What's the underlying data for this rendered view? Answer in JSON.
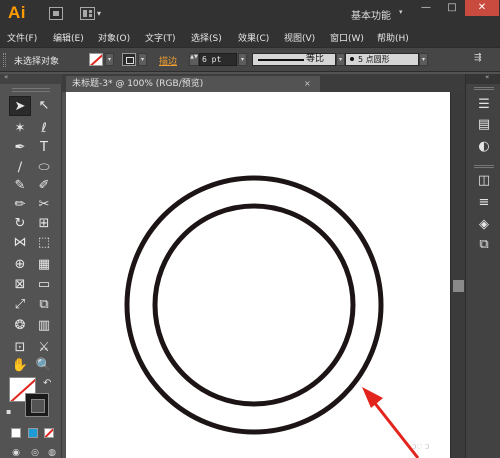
{
  "app": {
    "logo": "Ai",
    "workspace": "基本功能",
    "workspace_caret": "▾",
    "window_controls": {
      "minimize": "—",
      "maximize": "□",
      "close": "✕"
    }
  },
  "menu": [
    "文件(F)",
    "编辑(E)",
    "对象(O)",
    "文字(T)",
    "选择(S)",
    "效果(C)",
    "视图(V)",
    "窗口(W)",
    "帮助(H)"
  ],
  "control_bar": {
    "selection_label": "未选择对象",
    "stroke_label": "描边",
    "stroke_weight": "6 pt",
    "profile_label": "等比",
    "brush_label": "5 点圆形",
    "dropdown_glyph": "▾",
    "spinner_glyph": "▲▼",
    "panel_menu_icon": "⇶"
  },
  "document": {
    "tab_title": "未标题-3* @ 100% (RGB/预览)",
    "tab_close": "×"
  },
  "tools": [
    {
      "name": "selection-tool",
      "glyph": "➤"
    },
    {
      "name": "direct-selection-tool",
      "glyph": "↖"
    },
    {
      "name": "magic-wand-tool",
      "glyph": "✶"
    },
    {
      "name": "lasso-tool",
      "glyph": "ℓ"
    },
    {
      "name": "pen-tool",
      "glyph": "✒"
    },
    {
      "name": "type-tool",
      "glyph": "T"
    },
    {
      "name": "line-segment-tool",
      "glyph": "∕"
    },
    {
      "name": "ellipse-tool",
      "glyph": "⬭"
    },
    {
      "name": "paintbrush-tool",
      "glyph": "✎"
    },
    {
      "name": "pencil-tool",
      "glyph": "✐"
    },
    {
      "name": "blob-brush-tool",
      "glyph": "✏"
    },
    {
      "name": "scissors-tool",
      "glyph": "✂"
    },
    {
      "name": "rotate-tool",
      "glyph": "↻"
    },
    {
      "name": "scale-tool",
      "glyph": "⊞"
    },
    {
      "name": "width-tool",
      "glyph": "⋈"
    },
    {
      "name": "free-transform-tool",
      "glyph": "⬚"
    },
    {
      "name": "shape-builder-tool",
      "glyph": "⊕"
    },
    {
      "name": "perspective-grid-tool",
      "glyph": "▦"
    },
    {
      "name": "mesh-tool",
      "glyph": "⊠"
    },
    {
      "name": "gradient-tool",
      "glyph": "▭"
    },
    {
      "name": "eyedropper-tool",
      "glyph": "⤢"
    },
    {
      "name": "blend-tool",
      "glyph": "⧉"
    },
    {
      "name": "symbol-sprayer-tool",
      "glyph": "❂"
    },
    {
      "name": "column-graph-tool",
      "glyph": "▥"
    },
    {
      "name": "artboard-tool",
      "glyph": "⊡"
    },
    {
      "name": "slice-tool",
      "glyph": "⚔"
    },
    {
      "name": "hand-tool",
      "glyph": "✋"
    },
    {
      "name": "zoom-tool",
      "glyph": "🔍"
    }
  ],
  "color_controls": {
    "swap_icon": "↶",
    "default_icon": "▪"
  },
  "right_dock": {
    "collapse": "«",
    "panels": [
      {
        "name": "layers-menu-icon",
        "glyph": "☰"
      },
      {
        "name": "gradient-panel-icon",
        "glyph": "▤"
      },
      {
        "name": "color-panel-icon",
        "glyph": "◐"
      },
      {
        "name": "appearance-panel-icon",
        "glyph": "◫"
      },
      {
        "name": "stroke-panel-icon",
        "glyph": "≡"
      },
      {
        "name": "layers-panel-icon",
        "glyph": "◈"
      },
      {
        "name": "artboards-panel-icon",
        "glyph": "⧉"
      }
    ]
  },
  "left_collapse": "«",
  "watermark": "ↄ◌"
}
